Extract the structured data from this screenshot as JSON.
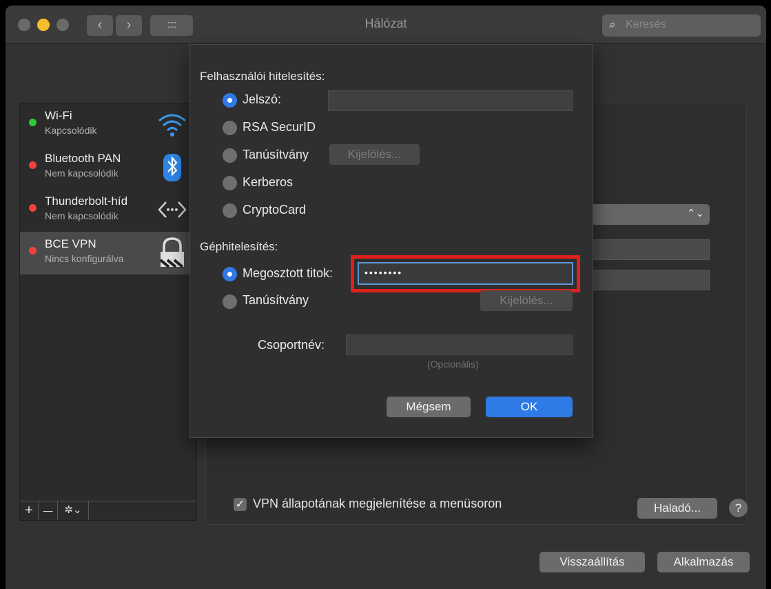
{
  "window": {
    "title": "Hálózat",
    "search_placeholder": "Keresés",
    "nav_back": "‹",
    "nav_forward": "›",
    "grid_icon": "::::"
  },
  "services": [
    {
      "name": "Wi-Fi",
      "status": "Kapcsolódik",
      "status_color": "#2dc937",
      "icon": "wifi-icon"
    },
    {
      "name": "Bluetooth PAN",
      "status": "Nem kapcsolódik",
      "status_color": "#f2413a",
      "icon": "bluetooth-icon"
    },
    {
      "name": "Thunderbolt-híd",
      "status": "Nem kapcsolódik",
      "status_color": "#f2413a",
      "icon": "thunderbolt-bridge-icon"
    },
    {
      "name": "BCE VPN",
      "status": "Nincs konfigurálva",
      "status_color": "#f2413a",
      "icon": "vpn-lock-icon",
      "selected": true
    }
  ],
  "sidebar_toolbar": {
    "add": "+",
    "remove": "—",
    "gear": "✲⌄"
  },
  "sheet": {
    "user_auth_label": "Felhasználói hitelesítés:",
    "user_auth_options": [
      {
        "label": "Jelszó:",
        "selected": true
      },
      {
        "label": "RSA SecurID",
        "selected": false
      },
      {
        "label": "Tanúsítvány",
        "selected": false
      },
      {
        "label": "Kerberos",
        "selected": false
      },
      {
        "label": "CryptoCard",
        "selected": false
      }
    ],
    "password_value": "",
    "select_button": "Kijelölés...",
    "machine_auth_label": "Géphitelesítés:",
    "machine_auth_options": [
      {
        "label": "Megosztott titok:",
        "selected": true
      },
      {
        "label": "Tanúsítvány",
        "selected": false
      }
    ],
    "shared_secret_value": "••••••••",
    "machine_select_button": "Kijelölés...",
    "group_name_label": "Csoportnév:",
    "group_name_value": "",
    "optional_hint": "(Opcionális)",
    "cancel_button": "Mégsem",
    "ok_button": "OK"
  },
  "main": {
    "show_vpn_label": "VPN állapotának megjelenítése a menüsoron",
    "show_vpn_checked": true,
    "advanced_button": "Haladó...",
    "help_button": "?",
    "revert_button": "Visszaállítás",
    "apply_button": "Alkalmazás"
  },
  "colors": {
    "accent": "#2f7ae5",
    "highlight_frame": "#e0201a",
    "yellow_light": "#f5be2d"
  }
}
